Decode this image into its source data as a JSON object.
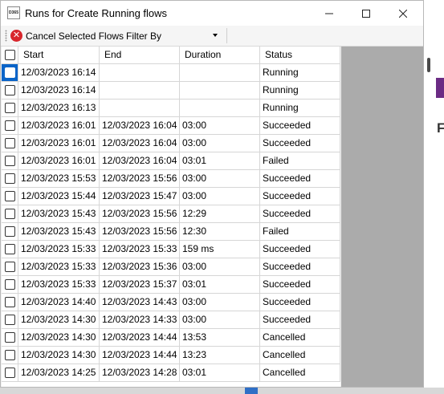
{
  "window": {
    "title": "Runs for Create Running flows",
    "icon_text": "D365",
    "controls": [
      "minimize-icon",
      "maximize-icon",
      "close-icon"
    ]
  },
  "toolbar": {
    "cancel_label": "Cancel Selected Flows",
    "filter_label": "Filter By"
  },
  "grid": {
    "columns": [
      "Start",
      "End",
      "Duration",
      "Status"
    ],
    "rows": [
      [
        "12/03/2023 16:14",
        "",
        "",
        "Running"
      ],
      [
        "12/03/2023 16:14",
        "",
        "",
        "Running"
      ],
      [
        "12/03/2023 16:13",
        "",
        "",
        "Running"
      ],
      [
        "12/03/2023 16:01",
        "12/03/2023 16:04",
        "03:00",
        "Succeeded"
      ],
      [
        "12/03/2023 16:01",
        "12/03/2023 16:04",
        "03:00",
        "Succeeded"
      ],
      [
        "12/03/2023 16:01",
        "12/03/2023 16:04",
        "03:01",
        "Failed"
      ],
      [
        "12/03/2023 15:53",
        "12/03/2023 15:56",
        "03:00",
        "Succeeded"
      ],
      [
        "12/03/2023 15:44",
        "12/03/2023 15:47",
        "03:00",
        "Succeeded"
      ],
      [
        "12/03/2023 15:43",
        "12/03/2023 15:56",
        "12:29",
        "Succeeded"
      ],
      [
        "12/03/2023 15:43",
        "12/03/2023 15:56",
        "12:30",
        "Failed"
      ],
      [
        "12/03/2023 15:33",
        "12/03/2023 15:33",
        "159 ms",
        "Succeeded"
      ],
      [
        "12/03/2023 15:33",
        "12/03/2023 15:36",
        "03:00",
        "Succeeded"
      ],
      [
        "12/03/2023 15:33",
        "12/03/2023 15:37",
        "03:01",
        "Succeeded"
      ],
      [
        "12/03/2023 14:40",
        "12/03/2023 14:43",
        "03:00",
        "Succeeded"
      ],
      [
        "12/03/2023 14:30",
        "12/03/2023 14:33",
        "03:00",
        "Succeeded"
      ],
      [
        "12/03/2023 14:30",
        "12/03/2023 14:44",
        "13:53",
        "Cancelled"
      ],
      [
        "12/03/2023 14:30",
        "12/03/2023 14:44",
        "13:23",
        "Cancelled"
      ],
      [
        "12/03/2023 14:25",
        "12/03/2023 14:28",
        "03:01",
        "Cancelled"
      ]
    ]
  },
  "background": {
    "peek_letter": "F"
  },
  "colors": {
    "selection": "#0a64c8",
    "cancel_icon": "#d8262c"
  }
}
